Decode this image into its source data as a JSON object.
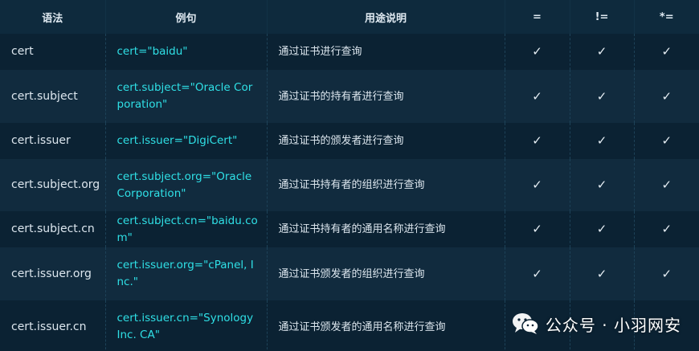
{
  "table": {
    "headers": [
      "语法",
      "例句",
      "用途说明",
      "=",
      "!=",
      "*="
    ],
    "check_mark": "✓",
    "rows": [
      {
        "syntax": "cert",
        "example": "cert=\"baidu\"",
        "desc": "通过证书进行查询"
      },
      {
        "syntax": "cert.subject",
        "example": "cert.subject=\"Oracle Corporation\"",
        "desc": "通过证书的持有者进行查询"
      },
      {
        "syntax": "cert.issuer",
        "example": "cert.issuer=\"DigiCert\"",
        "desc": "通过证书的颁发者进行查询"
      },
      {
        "syntax": "cert.subject.org",
        "example": "cert.subject.org=\"Oracle Corporation\"",
        "desc": "通过证书持有者的组织进行查询"
      },
      {
        "syntax": "cert.subject.cn",
        "example": "cert.subject.cn=\"baidu.com\"",
        "desc": "通过证书持有者的通用名称进行查询"
      },
      {
        "syntax": "cert.issuer.org",
        "example": "cert.issuer.org=\"cPanel, Inc.\"",
        "desc": "通过证书颁发者的组织进行查询"
      },
      {
        "syntax": "cert.issuer.cn",
        "example": "cert.issuer.cn=\"Synology Inc. CA\"",
        "desc": "通过证书颁发者的通用名称进行查询"
      }
    ]
  },
  "watermark": {
    "icon": "wechat-icon",
    "text": "公众号 · 小羽网安"
  },
  "colors": {
    "background": "#0b2233",
    "row_alt": "#112b3e",
    "header": "#0e2a3d",
    "example_text": "#2fe0e6",
    "body_text": "#dce6ee"
  }
}
